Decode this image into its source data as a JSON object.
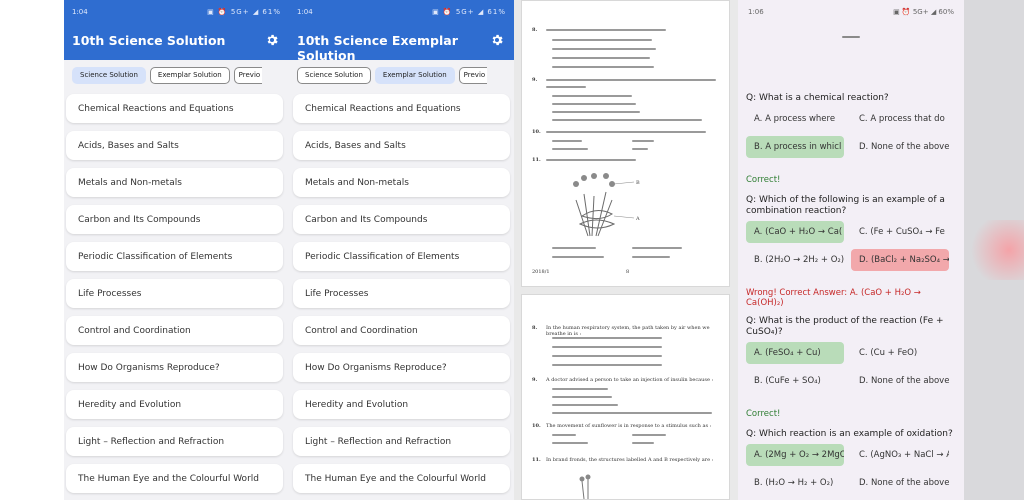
{
  "phone1": {
    "status_time": "1:04",
    "status_right": "▣ ⏰ 5G+ ◢ 61%",
    "title": "10th Science Solution",
    "tabs": [
      "Science Solution",
      "Exemplar Solution",
      "Previo"
    ],
    "active_tab": 0,
    "items": [
      "Chemical Reactions and Equations",
      "Acids, Bases and Salts",
      "Metals and Non-metals",
      "Carbon and Its Compounds",
      "Periodic Classification of Elements",
      "Life Processes",
      "Control and Coordination",
      "How Do Organisms Reproduce?",
      "Heredity and Evolution",
      "Light – Reflection and Refraction",
      "The Human Eye and the Colourful World"
    ]
  },
  "phone2": {
    "status_time": "1:04",
    "status_right": "▣ ⏰ 5G+ ◢ 61%",
    "title": "10th Science Exemplar Solution",
    "tabs": [
      "Science Solution",
      "Exemplar Solution",
      "Previo"
    ],
    "active_tab": 1,
    "items": [
      "Chemical Reactions and Equations",
      "Acids, Bases and Salts",
      "Metals and Non-metals",
      "Carbon and Its Compounds",
      "Periodic Classification of Elements",
      "Life Processes",
      "Control and Coordination",
      "How Do Organisms Reproduce?",
      "Heredity and Evolution",
      "Light – Reflection and Refraction",
      "The Human Eye and the Colourful World"
    ]
  },
  "doc": {
    "page1_qnums": [
      "8.",
      "9.",
      "10.",
      "11."
    ],
    "page1_footer": "2018/1",
    "page1_pageno": "8",
    "page2_qnums": [
      "8.",
      "9.",
      "10.",
      "11."
    ],
    "page2_q8": "In the human respiratory system, the path taken by air when we breathe in is :",
    "page2_q9": "A doctor advised a person to take an injection of insulin because :",
    "page2_q10": "The movement of sunflower is in response to a stimulus such as :",
    "page2_q11": "In brand fronds, the structures labelled A and B respectively are :"
  },
  "quiz": {
    "status_time": "1:06",
    "status_right": "▣ ⏰ 5G+ ◢ 60%",
    "q1": {
      "text": "Q: What is a chemical reaction?",
      "options": [
        "A. A process where",
        "C. A process that do",
        "B. A process in whicl",
        "D. None of the above"
      ],
      "feedback": "Correct!"
    },
    "q2": {
      "text": "Q: Which of the following is an example of a combination reaction?",
      "options": [
        "A. (CaO + H₂O → Ca(",
        "C. (Fe + CuSO₄ → Fe",
        "B. (2H₂O → 2H₂ + O₂)",
        "D. (BaCl₂ + Na₂SO₄ →"
      ],
      "feedback": "Wrong! Correct Answer: A. (CaO + H₂O → Ca(OH)₂)"
    },
    "q3": {
      "text": "Q: What is the product of the reaction (Fe + CuSO₄)?",
      "options": [
        "A. (FeSO₄ + Cu)",
        "C. (Cu + FeO)",
        "B. (CuFe + SO₄)",
        "D. None of the above"
      ],
      "feedback": "Correct!"
    },
    "q4": {
      "text": "Q: Which reaction is an example of oxidation?",
      "options": [
        "A. (2Mg + O₂ → 2MgO",
        "C. (AgNO₃ + NaCl → A",
        "B. (H₂O → H₂ + O₂)",
        "D. None of the above"
      ]
    }
  },
  "colors": {
    "appbar": "#2f6dd0",
    "correct": "#b9dcb9",
    "wrong": "#f2a8ab"
  }
}
